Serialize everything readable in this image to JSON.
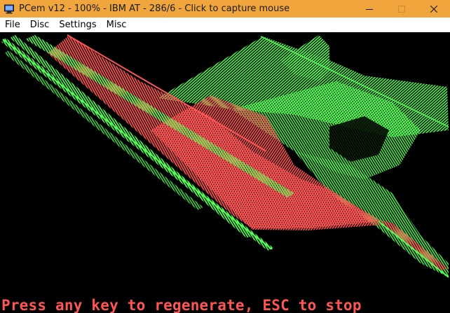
{
  "window": {
    "title": "PCem v12 - 100% - IBM AT - 286/6 - Click to capture mouse",
    "titlebar_color": "#f0a63c"
  },
  "menu": {
    "items": [
      {
        "label": "File"
      },
      {
        "label": "Disc"
      },
      {
        "label": "Settings"
      },
      {
        "label": "Misc"
      }
    ]
  },
  "screen": {
    "background": "#000000",
    "line_colors": [
      "#55ff55",
      "#ff5555"
    ],
    "prompt": "Press any key to regenerate, ESC to stop"
  }
}
